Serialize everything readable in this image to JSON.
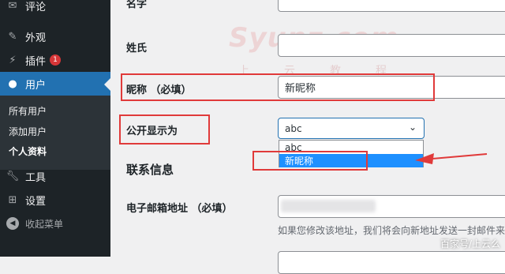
{
  "sidebar": {
    "items": [
      {
        "icon": "comment-icon",
        "label": "评论"
      },
      {
        "icon": "appearance-icon",
        "label": "外观"
      },
      {
        "icon": "plugins-icon",
        "label": "插件",
        "badge": "1"
      },
      {
        "icon": "users-icon",
        "label": "用户"
      }
    ],
    "submenu": [
      "所有用户",
      "添加用户",
      "个人资料"
    ],
    "after": [
      {
        "icon": "tools-icon",
        "label": "工具"
      },
      {
        "icon": "settings-icon",
        "label": "设置"
      }
    ],
    "collapse_label": "收起菜单"
  },
  "form": {
    "first_name_label": "名字",
    "last_name_label": "姓氏",
    "nickname_label": "昵称 （必填）",
    "nickname_value": "新昵称",
    "display_name_label": "公开显示为",
    "display_name_value": "abc",
    "display_options": [
      "abc",
      "新昵称"
    ],
    "contact_title": "联系信息",
    "email_label": "电子邮箱地址 （必填）",
    "email_desc": "如果您修改该地址，我们将会向新地址发送一封邮件来"
  },
  "watermark": {
    "text": "Syunz.com",
    "sub": "上云教程",
    "footer": "百家号/上云么"
  }
}
